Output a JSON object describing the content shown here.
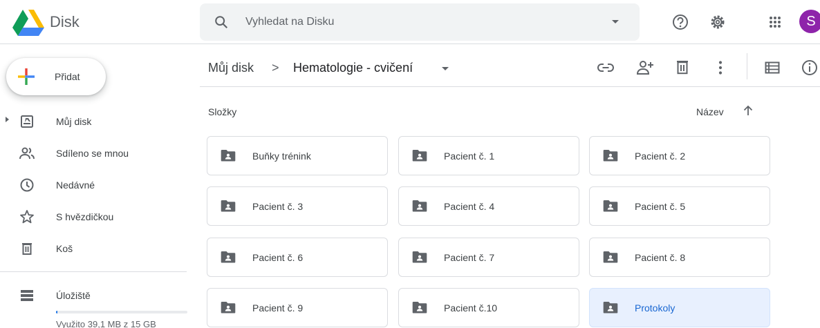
{
  "app": {
    "title": "Disk",
    "avatar_initial": "S"
  },
  "search": {
    "placeholder": "Vyhledat na Disku"
  },
  "sidebar": {
    "new_label": "Přidat",
    "items": [
      {
        "label": "Můj disk",
        "icon": "my-drive-icon"
      },
      {
        "label": "Sdíleno se mnou",
        "icon": "shared-icon"
      },
      {
        "label": "Nedávné",
        "icon": "clock-icon"
      },
      {
        "label": "S hvězdičkou",
        "icon": "star-icon"
      },
      {
        "label": "Koš",
        "icon": "trash-icon"
      }
    ],
    "storage": {
      "label": "Úložiště",
      "usage_text": "Využito 39,1 MB z 15 GB",
      "used_fraction": 0.0026
    }
  },
  "breadcrumb": {
    "root": "Můj disk",
    "separator": ">",
    "current": "Hematologie - cvičení"
  },
  "content": {
    "section_title": "Složky",
    "sort_label": "Název",
    "folders": [
      {
        "name": "Buňky trénink",
        "selected": false
      },
      {
        "name": "Pacient č. 1",
        "selected": false
      },
      {
        "name": "Pacient č. 2",
        "selected": false
      },
      {
        "name": "Pacient č. 3",
        "selected": false
      },
      {
        "name": "Pacient č. 4",
        "selected": false
      },
      {
        "name": "Pacient č. 5",
        "selected": false
      },
      {
        "name": "Pacient č. 6",
        "selected": false
      },
      {
        "name": "Pacient č. 7",
        "selected": false
      },
      {
        "name": "Pacient č. 8",
        "selected": false
      },
      {
        "name": "Pacient č. 9",
        "selected": false
      },
      {
        "name": "Pacient č.10",
        "selected": false
      },
      {
        "name": "Protokoly",
        "selected": true
      }
    ]
  },
  "colors": {
    "accent": "#1a73e8",
    "selected_bg": "#e8f0fe",
    "selected_text": "#1967d2",
    "avatar": "#8e24aa"
  }
}
